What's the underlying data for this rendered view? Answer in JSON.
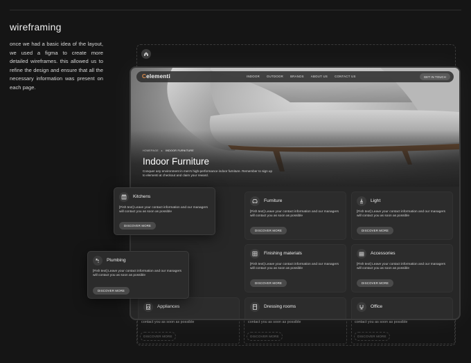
{
  "section": {
    "heading": "wireframing",
    "description": "once we had a basic idea of the layout, we used a figma to create more detailed wireframes. this allowed us to refine the design and ensure that all the necessary information was present on each page."
  },
  "site": {
    "logo": "elementi",
    "nav": [
      "INDOOR",
      "OUTDOOR",
      "BRANDS",
      "ABOUT US",
      "CONTACT US"
    ],
    "cta": "GET IN TOUCH",
    "breadcrumbs": [
      "HOMEPAGE",
      "INDOOR FURNITURE"
    ],
    "hero_title": "Indoor Furniture",
    "hero_text": "Conquer any environment in men's high-performance indoor furniture. Remember to sign up to elementi at checkout and claim your reward."
  },
  "cards": {
    "kitchens": {
      "title": "Kitchens",
      "text": "[Fish text] Leave your contact information and our managers will contact you as soon as possible",
      "button": "DISCOVER MORE"
    },
    "plumbing": {
      "title": "Plumbing",
      "text": "[Fish text] Leave your contact information and our managers will contact you as soon as possible",
      "button": "DISCOVER MORE"
    },
    "furniture": {
      "title": "Furniture",
      "text": "[Fish text] Leave your contact information and our managers will contact you as soon as possible",
      "button": "DISCOVER MORE"
    },
    "light": {
      "title": "Light",
      "text": "[Fish text] Leave your contact information and our managers will contact you as soon as possible",
      "button": "DISCOVER MORE"
    },
    "finishing": {
      "title": "Finishing materials",
      "text": "[Fish text] Leave your contact information and our managers will contact you as soon as possible",
      "button": "DISCOVER MORE"
    },
    "accessories": {
      "title": "Accessories",
      "text": "[Fish text] Leave your contact information and our managers will contact you as soon as possible",
      "button": "DISCOVER MORE"
    },
    "appliances": {
      "title": "Appliances"
    },
    "dressing": {
      "title": "Dressing rooms"
    },
    "office": {
      "title": "Office"
    }
  },
  "wireframe": {
    "overflow_text": "contact you as soon as possible",
    "button": "DISCOVER MORE"
  },
  "colors": {
    "background": "#151515",
    "accent": "#d98a4a"
  }
}
